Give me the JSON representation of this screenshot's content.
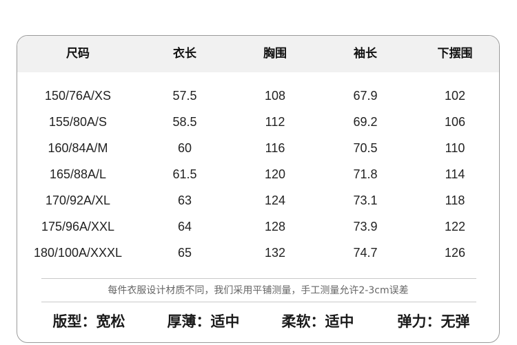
{
  "table": {
    "headers": [
      "尺码",
      "衣长",
      "胸围",
      "袖长",
      "下摆围"
    ],
    "rows": [
      [
        "150/76A/XS",
        "57.5",
        "108",
        "67.9",
        "102"
      ],
      [
        "155/80A/S",
        "58.5",
        "112",
        "69.2",
        "106"
      ],
      [
        "160/84A/M",
        "60",
        "116",
        "70.5",
        "110"
      ],
      [
        "165/88A/L",
        "61.5",
        "120",
        "71.8",
        "114"
      ],
      [
        "170/92A/XL",
        "63",
        "124",
        "73.1",
        "118"
      ],
      [
        "175/96A/XXL",
        "64",
        "128",
        "73.9",
        "122"
      ],
      [
        "180/100A/XXXL",
        "65",
        "132",
        "74.7",
        "126"
      ]
    ]
  },
  "note": "每件衣服设计材质不同，我们采用平铺测量，手工测量允许2-3cm误差",
  "attributes": [
    "版型：宽松",
    "厚薄：适中",
    "柔软：适中",
    "弹力：无弹"
  ]
}
